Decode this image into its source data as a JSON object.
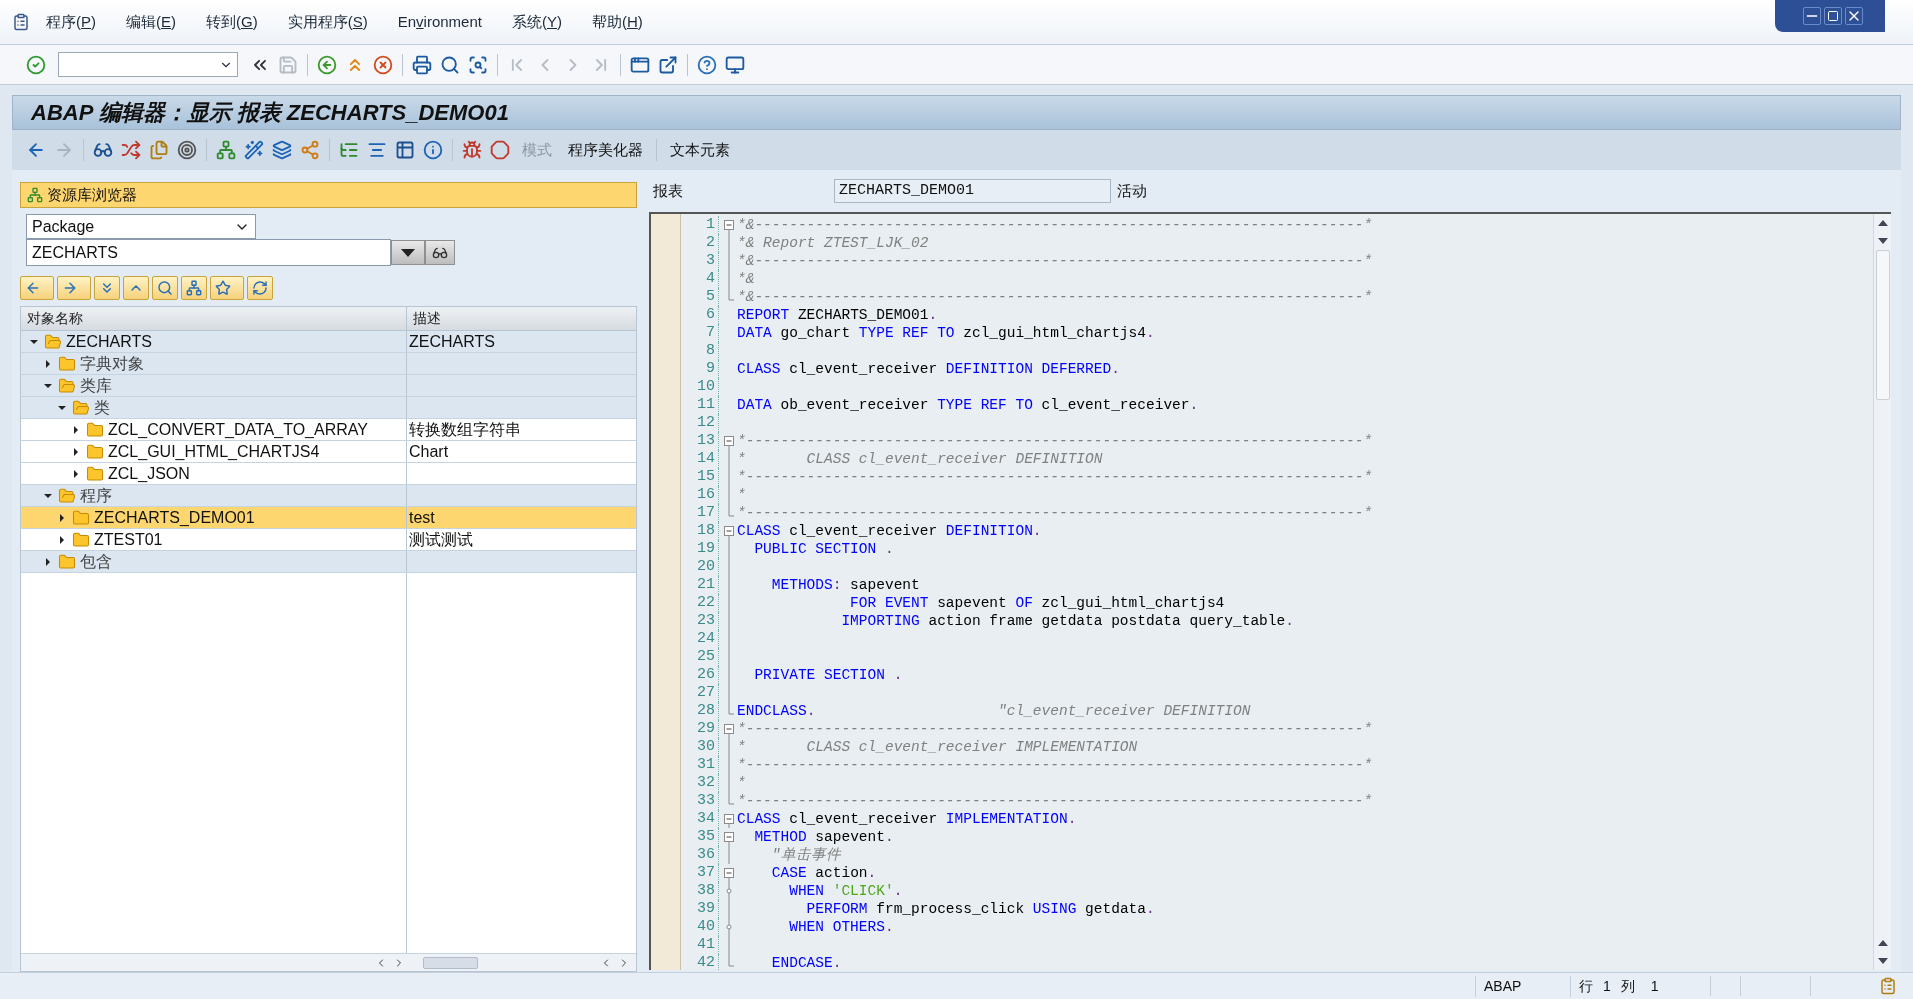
{
  "menu": [
    {
      "before": "程序(",
      "key": "P",
      "after": ")"
    },
    {
      "before": "编辑(",
      "key": "E",
      "after": ")"
    },
    {
      "before": "转到(",
      "key": "G",
      "after": ")"
    },
    {
      "before": "实用程序(",
      "key": "S",
      "after": ")"
    },
    {
      "before": "En",
      "key": "v",
      "after": "ironment"
    },
    {
      "before": "系统(",
      "key": "Y",
      "after": ")"
    },
    {
      "before": "帮助(",
      "key": "H",
      "after": ")"
    }
  ],
  "toolbar": [
    {
      "disabled": false
    },
    {
      "disabled": false
    },
    {
      "disabled": true
    },
    {
      "disabled": false
    },
    {
      "disabled": false
    },
    {
      "disabled": false
    },
    {
      "disabled": false
    },
    {
      "disabled": false
    },
    {
      "disabled": false
    },
    {
      "disabled": true
    },
    {
      "disabled": true
    },
    {
      "disabled": true
    },
    {
      "disabled": true
    },
    {
      "disabled": false
    },
    {
      "disabled": false
    },
    {
      "disabled": false
    },
    {
      "disabled": false
    }
  ],
  "title": "ABAP 编辑器：显示 报表 ZECHARTS_DEMO01",
  "app_toolbar": {
    "icons": [
      {
        "disabled": false
      },
      {
        "disabled": true
      },
      {
        "disabled": false
      },
      {
        "disabled": false
      },
      {
        "disabled": false
      },
      {
        "disabled": false
      },
      {
        "disabled": false
      },
      {
        "disabled": false
      },
      {
        "disabled": false
      },
      {
        "disabled": false
      },
      {
        "disabled": false
      },
      {
        "disabled": false
      },
      {
        "disabled": false
      },
      {
        "disabled": false
      },
      {
        "disabled": false
      },
      {
        "disabled": false
      }
    ],
    "buttons": [
      {
        "label": "模式",
        "disabled": true
      },
      {
        "label": "程序美化器",
        "disabled": false
      },
      {
        "label": "文本元素",
        "disabled": false
      }
    ]
  },
  "browser": {
    "header": "资源库浏览器",
    "object_type": "Package",
    "object_name": "ZECHARTS",
    "columns": [
      "对象名称",
      "描述"
    ],
    "tree": [
      {
        "name": "ZECHARTS",
        "desc": "ZECHARTS",
        "kind": "category",
        "expanded": true,
        "selected": false,
        "children": [
          {
            "name": "字典对象",
            "kind": "category",
            "expanded": false,
            "selected": false
          },
          {
            "name": "类库",
            "kind": "category",
            "expanded": true,
            "selected": false,
            "children": [
              {
                "name": "类",
                "kind": "category",
                "expanded": true,
                "selected": false,
                "children": [
                  {
                    "name": "ZCL_CONVERT_DATA_TO_ARRAY",
                    "desc": "转换数组字符串",
                    "kind": "object",
                    "expanded": false,
                    "selected": false
                  },
                  {
                    "name": "ZCL_GUI_HTML_CHARTJS4",
                    "desc": "Chart",
                    "kind": "object",
                    "expanded": false,
                    "selected": false
                  },
                  {
                    "name": "ZCL_JSON",
                    "kind": "object",
                    "expanded": false,
                    "selected": false
                  }
                ]
              }
            ]
          },
          {
            "name": "程序",
            "kind": "category",
            "expanded": true,
            "selected": false,
            "children": [
              {
                "name": "ZECHARTS_DEMO01",
                "desc": "test",
                "kind": "object",
                "expanded": false,
                "selected": true
              },
              {
                "name": "ZTEST01",
                "desc": "测试测试",
                "kind": "object",
                "expanded": false,
                "selected": false
              }
            ]
          },
          {
            "name": "包含",
            "kind": "category",
            "expanded": false,
            "selected": false
          }
        ]
      }
    ]
  },
  "editor": {
    "label": "报表",
    "program": "ZECHARTS_DEMO01",
    "status": "活动",
    "lines": [
      {
        "n": "1",
        "kind": "fold_start",
        "seg": [
          {
            "kind": "comment",
            "text": "*&----------------------------------------------------------------------*"
          }
        ]
      },
      {
        "n": "2",
        "kind": "fold_mid",
        "seg": [
          {
            "kind": "comment",
            "text": "*& Report ZTEST_LJK_02"
          }
        ]
      },
      {
        "n": "3",
        "kind": "fold_mid",
        "seg": [
          {
            "kind": "comment",
            "text": "*&----------------------------------------------------------------------*"
          }
        ]
      },
      {
        "n": "4",
        "kind": "fold_mid",
        "seg": [
          {
            "kind": "comment",
            "text": "*&"
          }
        ]
      },
      {
        "n": "5",
        "kind": "fold_end",
        "seg": [
          {
            "kind": "comment",
            "text": "*&----------------------------------------------------------------------*"
          }
        ]
      },
      {
        "n": "6",
        "kind": "plain",
        "seg": [
          {
            "kind": "keyword",
            "text": "REPORT"
          },
          {
            "kind": "text",
            "text": " ZECHARTS_DEMO01"
          },
          {
            "kind": "punct",
            "text": "."
          }
        ]
      },
      {
        "n": "7",
        "kind": "plain",
        "seg": [
          {
            "kind": "keyword",
            "text": "DATA"
          },
          {
            "kind": "text",
            "text": " go_chart "
          },
          {
            "kind": "keyword",
            "text": "TYPE REF TO"
          },
          {
            "kind": "text",
            "text": " zcl_gui_html_chartjs4"
          },
          {
            "kind": "punct",
            "text": "."
          }
        ]
      },
      {
        "n": "8",
        "kind": "plain"
      },
      {
        "n": "9",
        "kind": "plain",
        "seg": [
          {
            "kind": "keyword",
            "text": "CLASS"
          },
          {
            "kind": "text",
            "text": " cl_event_receiver "
          },
          {
            "kind": "keyword",
            "text": "DEFINITION DEFERRED"
          },
          {
            "kind": "punct",
            "text": "."
          }
        ]
      },
      {
        "n": "10",
        "kind": "plain"
      },
      {
        "n": "11",
        "kind": "plain",
        "seg": [
          {
            "kind": "keyword",
            "text": "DATA"
          },
          {
            "kind": "text",
            "text": " ob_event_receiver "
          },
          {
            "kind": "keyword",
            "text": "TYPE REF TO"
          },
          {
            "kind": "text",
            "text": " cl_event_receiver"
          },
          {
            "kind": "punct",
            "text": "."
          }
        ]
      },
      {
        "n": "12",
        "kind": "plain"
      },
      {
        "n": "13",
        "kind": "fold_start",
        "seg": [
          {
            "kind": "comment",
            "text": "*-----------------------------------------------------------------------*"
          }
        ]
      },
      {
        "n": "14",
        "kind": "fold_mid",
        "seg": [
          {
            "kind": "comment",
            "text": "*       CLASS cl_event_receiver DEFINITION"
          }
        ]
      },
      {
        "n": "15",
        "kind": "fold_mid",
        "seg": [
          {
            "kind": "comment",
            "text": "*-----------------------------------------------------------------------*"
          }
        ]
      },
      {
        "n": "16",
        "kind": "fold_mid",
        "seg": [
          {
            "kind": "comment",
            "text": "*"
          }
        ]
      },
      {
        "n": "17",
        "kind": "fold_end",
        "seg": [
          {
            "kind": "comment",
            "text": "*-----------------------------------------------------------------------*"
          }
        ]
      },
      {
        "n": "18",
        "kind": "fold_start",
        "seg": [
          {
            "kind": "keyword",
            "text": "CLASS"
          },
          {
            "kind": "text",
            "text": " cl_event_receiver "
          },
          {
            "kind": "keyword",
            "text": "DEFINITION"
          },
          {
            "kind": "punct",
            "text": "."
          }
        ]
      },
      {
        "n": "19",
        "kind": "fold_mid",
        "seg": [
          {
            "kind": "keyword",
            "text": "  PUBLIC SECTION"
          },
          {
            "kind": "punct",
            "text": " ."
          }
        ]
      },
      {
        "n": "20",
        "kind": "fold_mid"
      },
      {
        "n": "21",
        "kind": "fold_mid",
        "seg": [
          {
            "kind": "keyword",
            "text": "    METHODS"
          },
          {
            "kind": "punct",
            "text": ":"
          },
          {
            "kind": "text",
            "text": " sapevent"
          }
        ]
      },
      {
        "n": "22",
        "kind": "fold_mid",
        "seg": [
          {
            "kind": "keyword",
            "text": "             FOR EVENT"
          },
          {
            "kind": "text",
            "text": " sapevent "
          },
          {
            "kind": "keyword",
            "text": "OF"
          },
          {
            "kind": "text",
            "text": " zcl_gui_html_chartjs4"
          }
        ]
      },
      {
        "n": "23",
        "kind": "fold_mid",
        "seg": [
          {
            "kind": "keyword",
            "text": "            IMPORTING"
          },
          {
            "kind": "text",
            "text": " action frame getdata postdata query_table"
          },
          {
            "kind": "punct",
            "text": "."
          }
        ]
      },
      {
        "n": "24",
        "kind": "fold_mid"
      },
      {
        "n": "25",
        "kind": "fold_mid"
      },
      {
        "n": "26",
        "kind": "fold_mid",
        "seg": [
          {
            "kind": "keyword",
            "text": "  PRIVATE SECTION"
          },
          {
            "kind": "punct",
            "text": " ."
          }
        ]
      },
      {
        "n": "27",
        "kind": "fold_mid"
      },
      {
        "n": "28",
        "kind": "fold_end",
        "seg": [
          {
            "kind": "keyword",
            "text": "ENDCLASS"
          },
          {
            "kind": "punct",
            "text": "."
          },
          {
            "kind": "comment",
            "text": "                     \"cl_event_receiver DEFINITION"
          }
        ]
      },
      {
        "n": "29",
        "kind": "fold_start",
        "seg": [
          {
            "kind": "comment",
            "text": "*-----------------------------------------------------------------------*"
          }
        ]
      },
      {
        "n": "30",
        "kind": "fold_mid",
        "seg": [
          {
            "kind": "comment",
            "text": "*       CLASS cl_event_receiver IMPLEMENTATION"
          }
        ]
      },
      {
        "n": "31",
        "kind": "fold_mid",
        "seg": [
          {
            "kind": "comment",
            "text": "*-----------------------------------------------------------------------*"
          }
        ]
      },
      {
        "n": "32",
        "kind": "fold_mid",
        "seg": [
          {
            "kind": "comment",
            "text": "*"
          }
        ]
      },
      {
        "n": "33",
        "kind": "fold_end",
        "seg": [
          {
            "kind": "comment",
            "text": "*-----------------------------------------------------------------------*"
          }
        ]
      },
      {
        "n": "34",
        "kind": "fold_start",
        "seg": [
          {
            "kind": "keyword",
            "text": "CLASS"
          },
          {
            "kind": "text",
            "text": " cl_event_receiver "
          },
          {
            "kind": "keyword",
            "text": "IMPLEMENTATION"
          },
          {
            "kind": "punct",
            "text": "."
          }
        ]
      },
      {
        "n": "35",
        "kind": "fold_start",
        "seg": [
          {
            "kind": "keyword",
            "text": "  METHOD"
          },
          {
            "kind": "text",
            "text": " sapevent"
          },
          {
            "kind": "punct",
            "text": "."
          }
        ]
      },
      {
        "n": "36",
        "kind": "fold_mid",
        "seg": [
          {
            "kind": "comment",
            "text": "    \"单击事件"
          }
        ]
      },
      {
        "n": "37",
        "kind": "fold_start",
        "seg": [
          {
            "kind": "keyword",
            "text": "    CASE"
          },
          {
            "kind": "text",
            "text": " action"
          },
          {
            "kind": "punct",
            "text": "."
          }
        ]
      },
      {
        "n": "38",
        "kind": "fold_point",
        "seg": [
          {
            "kind": "keyword",
            "text": "      WHEN"
          },
          {
            "kind": "string",
            "text": " 'CLICK'"
          },
          {
            "kind": "punct",
            "text": "."
          }
        ]
      },
      {
        "n": "39",
        "kind": "fold_mid",
        "seg": [
          {
            "kind": "keyword",
            "text": "        PERFORM"
          },
          {
            "kind": "text",
            "text": " frm_process_click "
          },
          {
            "kind": "keyword",
            "text": "USING"
          },
          {
            "kind": "text",
            "text": " getdata"
          },
          {
            "kind": "punct",
            "text": "."
          }
        ]
      },
      {
        "n": "40",
        "kind": "fold_point",
        "seg": [
          {
            "kind": "keyword",
            "text": "      WHEN OTHERS"
          },
          {
            "kind": "punct",
            "text": "."
          }
        ]
      },
      {
        "n": "41",
        "kind": "fold_mid"
      },
      {
        "n": "42",
        "kind": "fold_end",
        "seg": [
          {
            "kind": "keyword",
            "text": "    ENDCASE"
          },
          {
            "kind": "punct",
            "text": "."
          }
        ]
      }
    ]
  },
  "status_bar": {
    "language": "ABAP",
    "row_label": "行",
    "row": "1",
    "col_label": "列",
    "col": "1"
  }
}
